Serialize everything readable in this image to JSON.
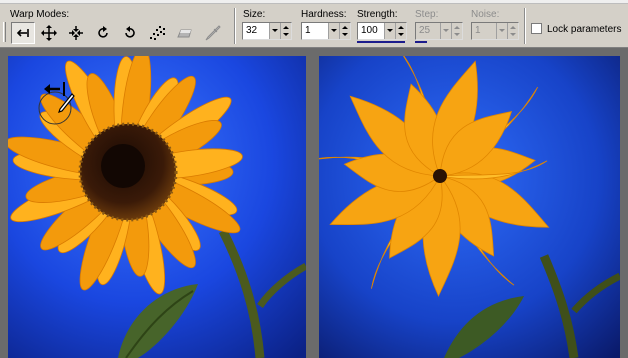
{
  "toolbar": {
    "warp_modes_label": "Warp Modes:",
    "tools": [
      {
        "name": "forward-warp",
        "icon": "arrow-left-bar-icon",
        "active": true
      },
      {
        "name": "move",
        "icon": "move-arrows-icon",
        "active": false
      },
      {
        "name": "pucker",
        "icon": "pucker-icon",
        "active": false
      },
      {
        "name": "twirl-clockwise",
        "icon": "rotate-cw-icon",
        "active": false
      },
      {
        "name": "twirl-counterclockwise",
        "icon": "rotate-ccw-icon",
        "active": false
      },
      {
        "name": "turbulence",
        "icon": "scatter-dots-icon",
        "active": false
      },
      {
        "name": "reconstruct",
        "icon": "eraser-icon",
        "active": false
      },
      {
        "name": "freeze",
        "icon": "knife-icon",
        "active": false
      }
    ],
    "size": {
      "label": "Size:",
      "value": "32"
    },
    "hardness": {
      "label": "Hardness:",
      "value": "1"
    },
    "strength": {
      "label": "Strength:",
      "value": "100"
    },
    "step": {
      "label": "Step:",
      "value": "25"
    },
    "noise": {
      "label": "Noise:",
      "value": "1"
    },
    "lock_parameters": {
      "label": "Lock parameters",
      "checked": false
    }
  },
  "canvas": {
    "left": {
      "title": "original sunflower",
      "cursor_icon": "warp-brush-cursor-icon"
    },
    "right": {
      "title": "warped sunflower"
    }
  },
  "colors": {
    "toolbar_bg": "#d4d0c8",
    "workspace_bg": "#6b6b6b",
    "petal": "#f8a510",
    "sky": "#1a47e0",
    "strength_bar": "#1c1c8c"
  }
}
